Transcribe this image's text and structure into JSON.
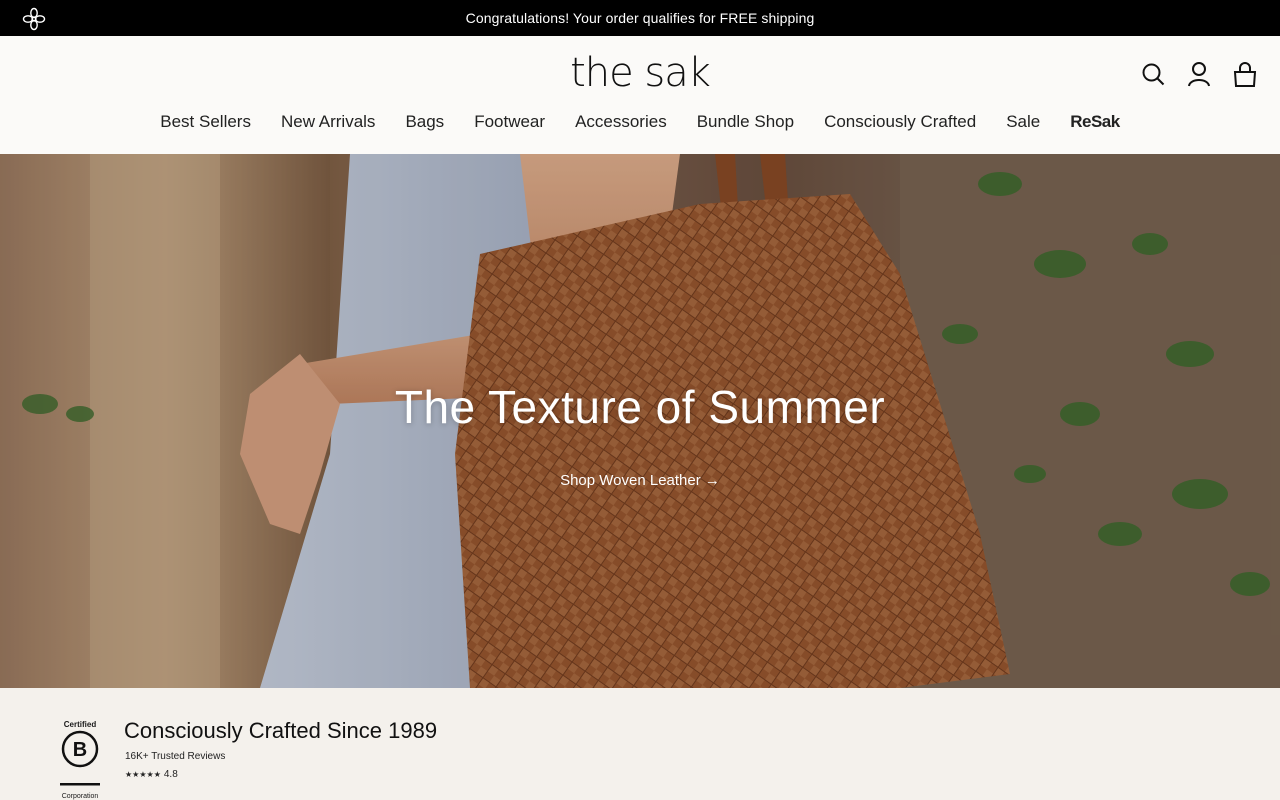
{
  "announcement": {
    "text": "Congratulations! Your order qualifies for FREE shipping",
    "icon": "flower-logo-icon"
  },
  "header": {
    "logo": "the sak",
    "icons": [
      "search-icon",
      "account-icon",
      "bag-icon"
    ]
  },
  "nav": {
    "items": [
      {
        "label": "Best Sellers"
      },
      {
        "label": "New Arrivals"
      },
      {
        "label": "Bags"
      },
      {
        "label": "Footwear"
      },
      {
        "label": "Accessories"
      },
      {
        "label": "Bundle Shop"
      },
      {
        "label": "Consciously Crafted"
      },
      {
        "label": "Sale"
      },
      {
        "label": "ReSak"
      }
    ]
  },
  "hero": {
    "title": "The Texture of Summer",
    "cta": "Shop Woven Leather →"
  },
  "strip": {
    "badge_certified": "Certified",
    "badge_letter": "B",
    "badge_corporation": "Corporation",
    "title": "Consciously Crafted Since 1989",
    "reviews": "16K+ Trusted Reviews",
    "stars": "★★★★★",
    "rating": "4.8"
  },
  "colors": {
    "announcement_bg": "#000000",
    "header_bg": "#fbfaf8",
    "strip_bg": "#f4f1ec",
    "leather": "#a8643a"
  }
}
